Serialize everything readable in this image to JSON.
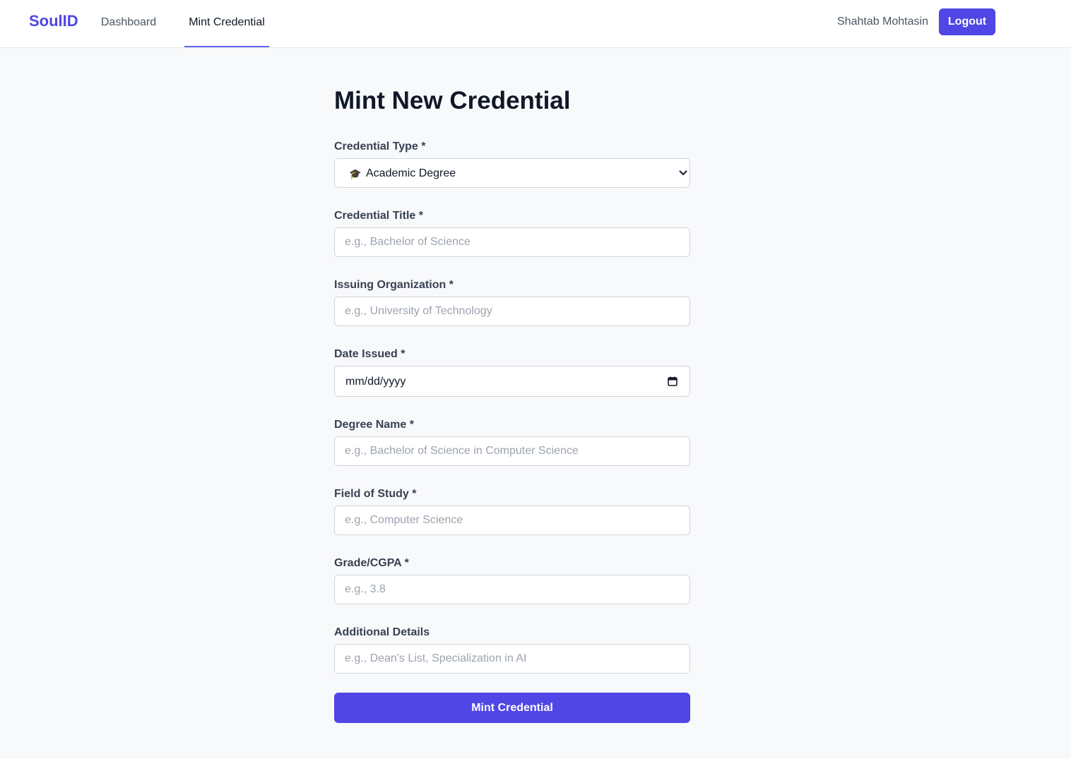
{
  "nav": {
    "brand": "SoulID",
    "links": [
      "Dashboard",
      "Mint Credential"
    ],
    "active": "Mint Credential",
    "user_name": "Shahtab Mohtasin",
    "logout_label": "Logout"
  },
  "form": {
    "title": "Mint New Credential",
    "credential_type": {
      "label": "Credential Type *",
      "selected_icon": "graduation-cap-icon",
      "selected_value": "Academic Degree"
    },
    "credential_title": {
      "label": "Credential Title *",
      "placeholder": "e.g., Bachelor of Science"
    },
    "issuing_org": {
      "label": "Issuing Organization *",
      "placeholder": "e.g., University of Technology"
    },
    "date_issued": {
      "label": "Date Issued *",
      "placeholder": "mm/dd/yyyy"
    },
    "degree_name": {
      "label": "Degree Name *",
      "placeholder": "e.g., Bachelor of Science in Computer Science"
    },
    "field_of_study": {
      "label": "Field of Study *",
      "placeholder": "e.g., Computer Science"
    },
    "grade": {
      "label": "Grade/CGPA *",
      "placeholder": "e.g., 3.8"
    },
    "additional": {
      "label": "Additional Details",
      "placeholder": "e.g., Dean's List, Specialization in AI"
    },
    "submit_label": "Mint Credential"
  },
  "colors": {
    "accent": "#4f46e5",
    "background": "#f8f9fb",
    "border": "#d1d5db"
  }
}
